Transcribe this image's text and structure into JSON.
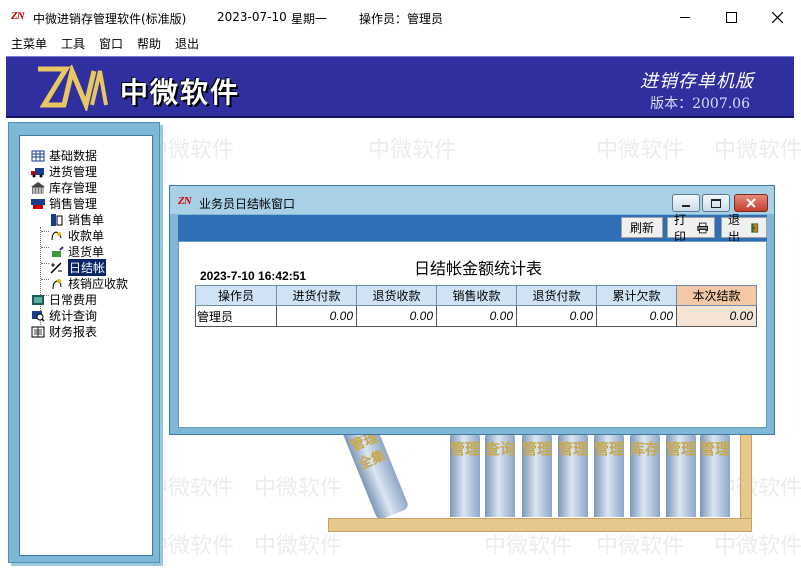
{
  "window": {
    "title": "中微进销存管理软件(标准版)",
    "date": "2023-07-10",
    "weekday": "星期一",
    "operator": "操作员：管理员",
    "logo_text": "ZN"
  },
  "menu": [
    {
      "label": "主菜单"
    },
    {
      "label": "工具"
    },
    {
      "label": "窗口"
    },
    {
      "label": "帮助"
    },
    {
      "label": "退出"
    }
  ],
  "banner": {
    "brand_name": "中微软件",
    "product": "进销存单机版",
    "version": "版本：2007.06"
  },
  "watermark_text": "中微软件",
  "nav": {
    "items": [
      {
        "label": "基础数据",
        "icon": "grid-icon"
      },
      {
        "label": "进货管理",
        "icon": "truck-icon"
      },
      {
        "label": "库存管理",
        "icon": "warehouse-icon"
      },
      {
        "label": "销售管理",
        "icon": "cart-icon"
      },
      {
        "label": "销售单",
        "icon": "receipt-icon"
      },
      {
        "label": "收款单",
        "icon": "hand-money-icon"
      },
      {
        "label": "退货单",
        "icon": "return-icon"
      },
      {
        "label": "日结帐",
        "icon": "percent-icon"
      },
      {
        "label": "核销应收款",
        "icon": "verify-icon"
      },
      {
        "label": "日常费用",
        "icon": "calendar-icon"
      },
      {
        "label": "统计查询",
        "icon": "search-chart-icon"
      },
      {
        "label": "财务报表",
        "icon": "report-icon"
      }
    ],
    "selected": "日结帐"
  },
  "books": {
    "spines": [
      "管理",
      "查询",
      "管理",
      "管理",
      "管理",
      "库存",
      "管理",
      "管理"
    ],
    "fallen": "管理全集"
  },
  "dialog": {
    "title": "业务员日结帐窗口",
    "logo_text": "ZN",
    "toolbar": {
      "refresh": "刷新",
      "print": "打印",
      "exit": "退出"
    },
    "report_title": "日结帐金额统计表",
    "datetime": "2023-7-10  16:42:51",
    "columns": [
      "操作员",
      "进货付款",
      "退货收款",
      "销售收款",
      "退货付款",
      "累计欠款",
      "本次结款"
    ],
    "rows": [
      [
        "管理员",
        "0.00",
        "0.00",
        "0.00",
        "0.00",
        "0.00",
        "0.00"
      ]
    ]
  }
}
